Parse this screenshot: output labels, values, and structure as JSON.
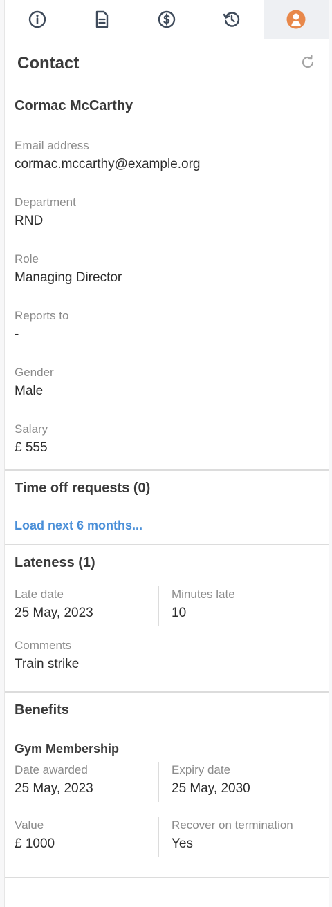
{
  "tabs": [
    {
      "name": "tab-info",
      "icon": "info-icon"
    },
    {
      "name": "tab-documents",
      "icon": "document-icon"
    },
    {
      "name": "tab-finance",
      "icon": "dollar-icon"
    },
    {
      "name": "tab-history",
      "icon": "history-icon"
    },
    {
      "name": "tab-contact",
      "icon": "person-icon",
      "active": true
    }
  ],
  "colors": {
    "accent": "#e8884a",
    "link": "#4a8fd8"
  },
  "header": {
    "title": "Contact",
    "refresh_icon": "refresh-icon"
  },
  "contact": {
    "name": "Cormac McCarthy",
    "fields": [
      {
        "label": "Email address",
        "value": "cormac.mccarthy@example.org"
      },
      {
        "label": "Department",
        "value": "RND"
      },
      {
        "label": "Role",
        "value": "Managing Director"
      },
      {
        "label": "Reports to",
        "value": "-"
      },
      {
        "label": "Gender",
        "value": "Male"
      },
      {
        "label": "Salary",
        "value": "£ 555"
      }
    ]
  },
  "time_off": {
    "title": "Time off requests (0)",
    "load_link": "Load next 6 months..."
  },
  "lateness": {
    "title": "Lateness (1)",
    "late_date_label": "Late date",
    "late_date": "25 May, 2023",
    "minutes_label": "Minutes late",
    "minutes": "10",
    "comments_label": "Comments",
    "comments": "Train strike"
  },
  "benefits": {
    "title": "Benefits",
    "items": [
      {
        "name": "Gym Membership",
        "date_awarded_label": "Date awarded",
        "date_awarded": "25 May, 2023",
        "expiry_label": "Expiry date",
        "expiry": "25 May, 2030",
        "value_label": "Value",
        "value": "£ 1000",
        "recover_label": "Recover on termination",
        "recover": "Yes"
      }
    ]
  }
}
